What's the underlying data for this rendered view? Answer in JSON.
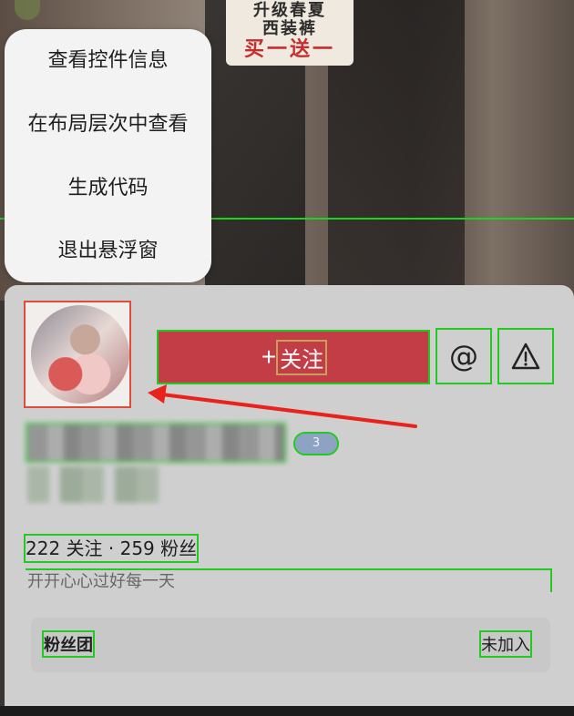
{
  "background": {
    "sign_lines": [
      "升级春夏",
      "西装裤",
      "买一送一"
    ]
  },
  "menu": {
    "items": [
      "查看控件信息",
      "在布局层次中查看",
      "生成代码",
      "退出悬浮窗"
    ]
  },
  "profile": {
    "follow_plus": "+",
    "follow_label": "关注",
    "mention_icon": "@",
    "report_icon": "warning-icon",
    "level": "3",
    "stats": "222 关注 · 259 粉丝",
    "bio": "开开心心过好每一天",
    "fan_club": {
      "title": "粉丝团",
      "status": "未加入"
    }
  },
  "colors": {
    "follow_button": "#c33d47",
    "highlight": "#22c922",
    "arrow": "#e8231c"
  }
}
